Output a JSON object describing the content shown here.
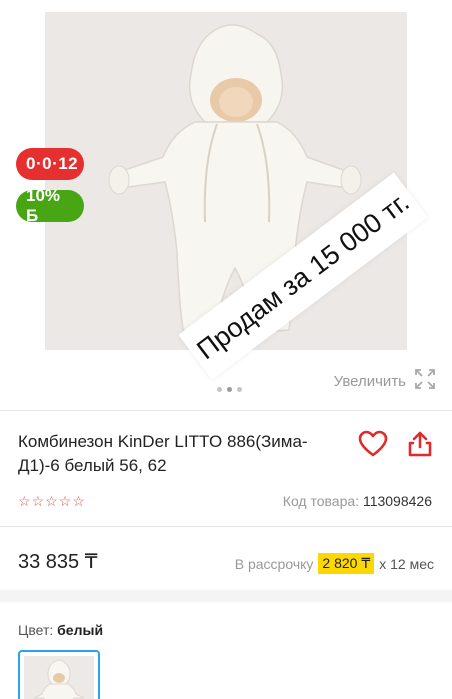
{
  "gallery": {
    "badge_installment": "0·0·12",
    "badge_bonus": "10% Б",
    "sale_banner": "Продам за 15 000 тг.",
    "zoom_label": "Увеличить",
    "dots_count": 3,
    "active_dot": 1
  },
  "product": {
    "title": "Комбинезон KinDer LITTO 886(Зима-Д1)-6 белый 56, 62",
    "rating": 0,
    "sku_label": "Код товара:",
    "sku_value": "113098426",
    "price": "33 835 ₸",
    "installment_label": "В рассрочку",
    "installment_amount": "2 820 ₸",
    "installment_term": "x 12 мес"
  },
  "options": {
    "color_label": "Цвет:",
    "color_value": "белый"
  },
  "colors": {
    "installment_badge": "#e6302f",
    "bonus_badge": "#48a614",
    "favorite": "#e02b2b",
    "share": "#e02b2b",
    "highlight": "#fcd800",
    "selected_border": "#2aa3e8"
  }
}
